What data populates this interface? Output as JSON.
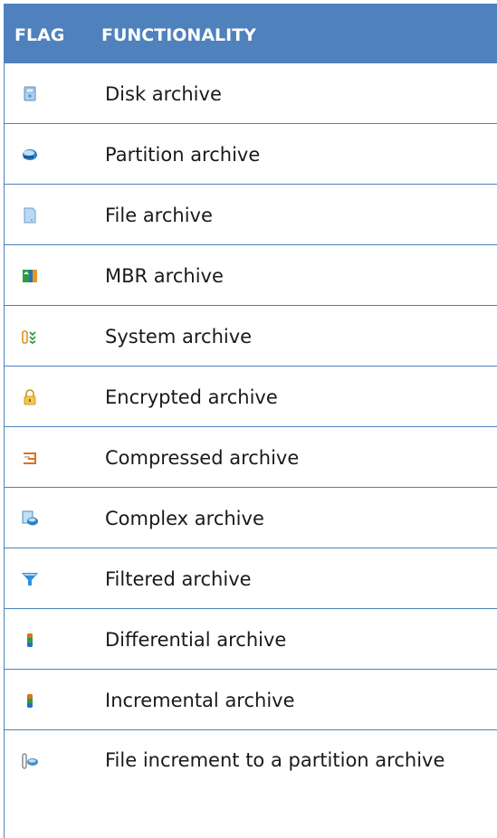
{
  "table": {
    "headers": {
      "flag": "FLAG",
      "functionality": "FUNCTIONALITY"
    },
    "rows": [
      {
        "icon": "disk-archive-icon",
        "label": "Disk archive"
      },
      {
        "icon": "partition-archive-icon",
        "label": "Partition archive"
      },
      {
        "icon": "file-archive-icon",
        "label": "File archive"
      },
      {
        "icon": "mbr-archive-icon",
        "label": "MBR archive"
      },
      {
        "icon": "system-archive-icon",
        "label": "System archive"
      },
      {
        "icon": "lock-icon",
        "label": "Encrypted archive"
      },
      {
        "icon": "clamp-icon",
        "label": "Compressed archive"
      },
      {
        "icon": "complex-archive-icon",
        "label": "Complex archive"
      },
      {
        "icon": "funnel-icon",
        "label": "Filtered archive"
      },
      {
        "icon": "differential-archive-icon",
        "label": "Differential archive"
      },
      {
        "icon": "incremental-archive-icon",
        "label": "Incremental archive"
      },
      {
        "icon": "file-increment-icon",
        "label": "File increment to a partition archive"
      }
    ]
  },
  "colors": {
    "header_bg": "#4f81bd",
    "header_text": "#ffffff",
    "rule": "#4f81bd"
  }
}
